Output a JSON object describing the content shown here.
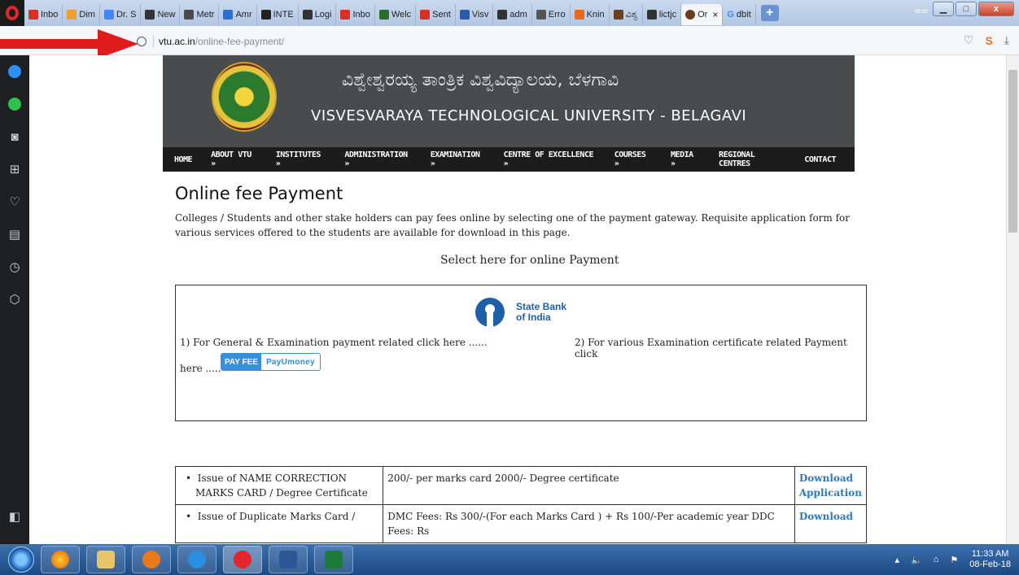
{
  "browser": {
    "tabs": [
      {
        "label": "Inbo",
        "color": "#d93025"
      },
      {
        "label": "Dim",
        "color": "#f0a030"
      },
      {
        "label": "Dr. S",
        "color": "#4285f4"
      },
      {
        "label": "New",
        "color": "#333333"
      },
      {
        "label": "Metr",
        "color": "#4a4a4a"
      },
      {
        "label": "Amr",
        "color": "#2b6fcf"
      },
      {
        "label": "INTE",
        "color": "#222222"
      },
      {
        "label": "Logi",
        "color": "#333333"
      },
      {
        "label": "Inbo",
        "color": "#d93025"
      },
      {
        "label": "Welc",
        "color": "#2a6d2a"
      },
      {
        "label": "Sent",
        "color": "#d93025"
      },
      {
        "label": "Visv",
        "color": "#2b5aa8"
      },
      {
        "label": "adm",
        "color": "#333333"
      },
      {
        "label": "Erro",
        "color": "#555555"
      },
      {
        "label": "Knin",
        "color": "#e66a1f"
      },
      {
        "label": "ವಿಶ್ವ",
        "color": "#6b3f1d"
      },
      {
        "label": "lictjc",
        "color": "#333333"
      }
    ],
    "active_tab": {
      "label": "Or",
      "close": "×"
    },
    "last_tab": {
      "label": "dbit",
      "icon": "G"
    },
    "new_tab": "+",
    "url_domain": "vtu.ac.in",
    "url_path": "/online-fee-payment/",
    "window_controls": {
      "min": "▁",
      "max": "□",
      "close": "x"
    }
  },
  "sidebar": {
    "icons": [
      "messenger-icon",
      "whatsapp-icon",
      "camera-icon",
      "speed-dial-icon",
      "heart-icon",
      "news-icon",
      "history-icon",
      "extensions-icon"
    ]
  },
  "site": {
    "kannada_title": "ವಿಶ್ವೇಶ್ವರಯ್ಯ ತಾಂತ್ರಿಕ ವಿಶ್ವವಿದ್ಯಾಲಯ, ಬೆಳಗಾವಿ",
    "english_title": "VISVESVARAYA TECHNOLOGICAL UNIVERSITY - BELAGAVI",
    "nav": [
      "HOME",
      "ABOUT VTU »",
      "INSTITUTES »",
      "ADMINISTRATION »",
      "EXAMINATION »",
      "CENTRE OF EXCELLENCE »",
      "COURSES »",
      "MEDIA »",
      "REGIONAL CENTRES",
      "CONTACT"
    ]
  },
  "page": {
    "title": "Online fee Payment",
    "intro": "Colleges / Students and other stake holders can pay fees online by selecting one of the payment gateway.  Requisite application form for various services offered to the students are available for download in this page.",
    "select_heading": "Select here for online Payment",
    "sbi_line1": "State Bank",
    "sbi_line2": "of India",
    "general_text": "1) For General & Examination payment related  click here ......",
    "general_here": "here .....",
    "payfee_label": "PAY FEE",
    "payu_label": "PayUmoney",
    "cert_text": "2) For various Examination certificate related  Payment click"
  },
  "fee_table": {
    "rows": [
      {
        "service": "Issue of NAME CORRECTION MARKS CARD / Degree Certificate",
        "fee": "200/- per marks card  2000/- Degree certificate",
        "link": "Download Application"
      },
      {
        "service": "Issue of Duplicate Marks Card /",
        "fee": "DMC Fees: Rs 300/-(For each Marks Card ) + Rs 100/-Per academic year DDC Fees: Rs",
        "link": "Download"
      }
    ]
  },
  "taskbar": {
    "time": "11:33 AM",
    "date": "08-Feb-18"
  }
}
